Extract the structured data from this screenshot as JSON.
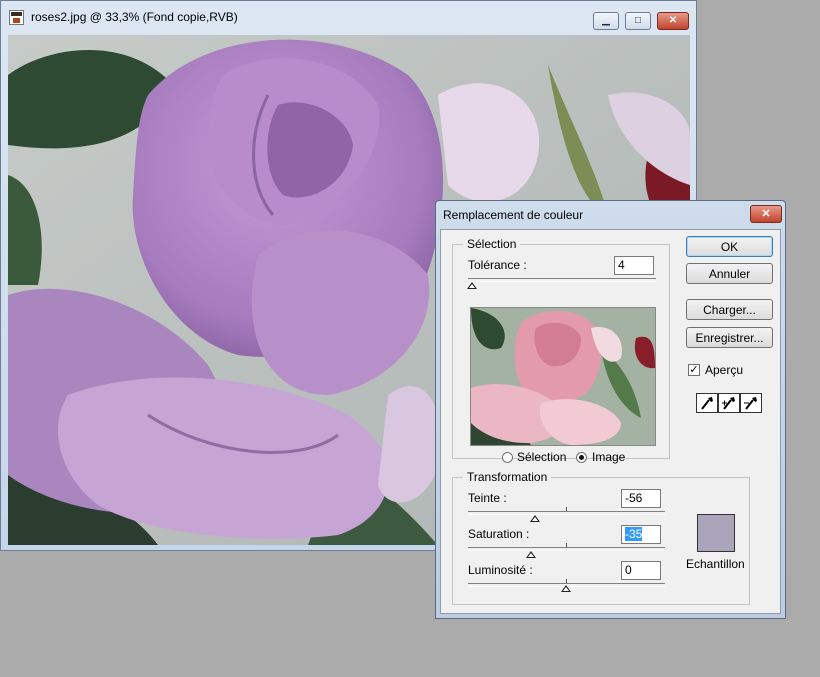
{
  "document_window": {
    "title": "roses2.jpg @ 33,3% (Fond copie,RVB)",
    "controls": {
      "minimize_icon": "minimize-icon",
      "maximize_icon": "maximize-icon",
      "close_icon": "close-icon"
    }
  },
  "dialog": {
    "title": "Remplacement de couleur",
    "selection_group": {
      "legend": "Sélection",
      "tolerance_label": "Tolérance :",
      "tolerance_value": "4",
      "tolerance_fraction": 0.02,
      "radio_selection": "Sélection",
      "radio_image": "Image",
      "active_radio": "image"
    },
    "transformation_group": {
      "legend": "Transformation",
      "hue_label": "Teinte :",
      "hue_value": "-56",
      "saturation_label": "Saturation :",
      "saturation_value": "-35",
      "luminosity_label": "Luminosité :",
      "luminosity_value": "0",
      "swatch_label": "Echantillon",
      "swatch_color": "#aaa5bb"
    },
    "buttons": {
      "ok": "OK",
      "cancel": "Annuler",
      "load": "Charger...",
      "save": "Enregistrer..."
    },
    "preview_label": "Aperçu",
    "preview_checked": true,
    "tools": [
      "eyedropper-icon",
      "eyedropper-plus-icon",
      "eyedropper-minus-icon"
    ]
  }
}
